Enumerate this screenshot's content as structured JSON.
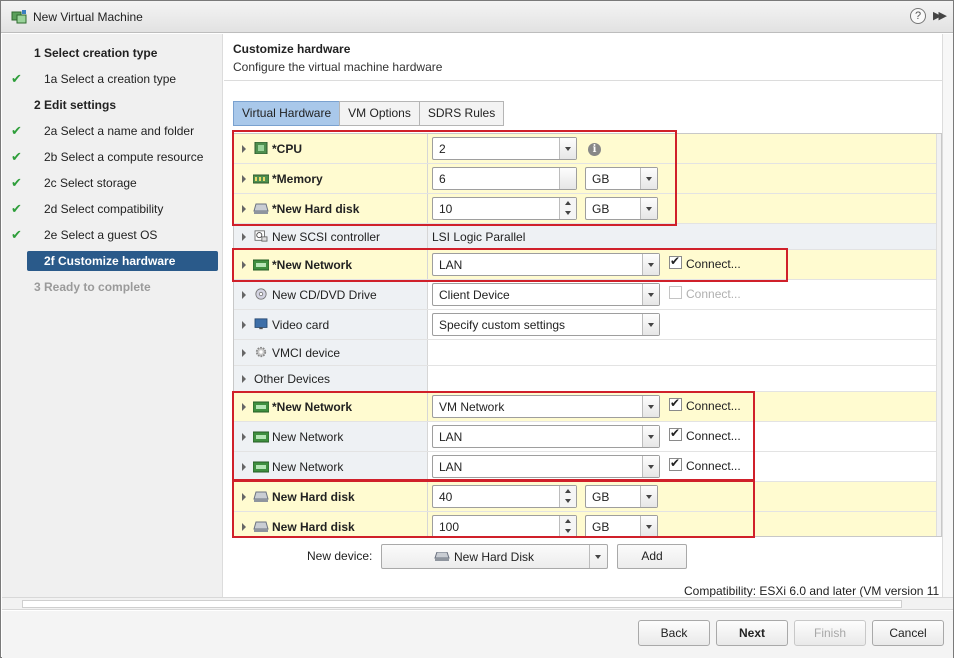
{
  "window": {
    "title": "New Virtual Machine",
    "help_glyph": "?",
    "expand_glyph": "▶▶"
  },
  "sidebar": {
    "items": [
      {
        "label": "1  Select creation type",
        "type": "header",
        "checked": false
      },
      {
        "label": "1a  Select a creation type",
        "type": "sub",
        "checked": true
      },
      {
        "label": "2  Edit settings",
        "type": "header",
        "checked": false
      },
      {
        "label": "2a  Select a name and folder",
        "type": "sub",
        "checked": true
      },
      {
        "label": "2b  Select a compute resource",
        "type": "sub",
        "checked": true
      },
      {
        "label": "2c  Select storage",
        "type": "sub",
        "checked": true
      },
      {
        "label": "2d  Select compatibility",
        "type": "sub",
        "checked": true
      },
      {
        "label": "2e  Select a guest OS",
        "type": "sub",
        "checked": true
      },
      {
        "label": "2f  Customize hardware",
        "type": "active",
        "checked": false
      },
      {
        "label": "3  Ready to complete",
        "type": "disabled",
        "checked": false
      }
    ],
    "check_glyph": "✔"
  },
  "main": {
    "title": "Customize hardware",
    "subtitle": "Configure the virtual machine hardware",
    "tabs": [
      {
        "label": "Virtual Hardware",
        "active": true
      },
      {
        "label": "VM Options",
        "active": false
      },
      {
        "label": "SDRS Rules",
        "active": false
      }
    ],
    "rows": {
      "cpu": {
        "label": "*CPU",
        "value": "2",
        "info": "i"
      },
      "memory": {
        "label": "*Memory",
        "value": "6",
        "unit": "GB"
      },
      "disk1": {
        "label": "*New Hard disk",
        "value": "10",
        "unit": "GB"
      },
      "scsi": {
        "label": "New SCSI controller",
        "value": "LSI Logic Parallel"
      },
      "net1": {
        "label": "*New Network",
        "value": "LAN",
        "connect": "Connect..."
      },
      "cdrom": {
        "label": "New CD/DVD Drive",
        "value": "Client Device",
        "connect": "Connect..."
      },
      "video": {
        "label": "Video card",
        "value": "Specify custom settings"
      },
      "vmci": {
        "label": "VMCI device"
      },
      "other": {
        "label": "Other Devices"
      },
      "net2": {
        "label": "*New Network",
        "value": "VM Network",
        "connect": "Connect..."
      },
      "net3": {
        "label": "New Network",
        "value": "LAN",
        "connect": "Connect..."
      },
      "net4": {
        "label": "New Network",
        "value": "LAN",
        "connect": "Connect..."
      },
      "disk2": {
        "label": "New Hard disk",
        "value": "40",
        "unit": "GB"
      },
      "disk3": {
        "label": "New Hard disk",
        "value": "100",
        "unit": "GB"
      }
    },
    "new_device": {
      "label": "New device:",
      "value": "New Hard Disk",
      "add_label": "Add"
    },
    "compatibility": "Compatibility: ESXi 6.0 and later (VM version 11"
  },
  "footer": {
    "back": "Back",
    "next": "Next",
    "finish": "Finish",
    "cancel": "Cancel"
  },
  "colors": {
    "highlight": "#fffbd0",
    "annotation_red": "#d0202a",
    "active_step": "#2a5a8a",
    "active_tab": "#a9c8ea"
  }
}
